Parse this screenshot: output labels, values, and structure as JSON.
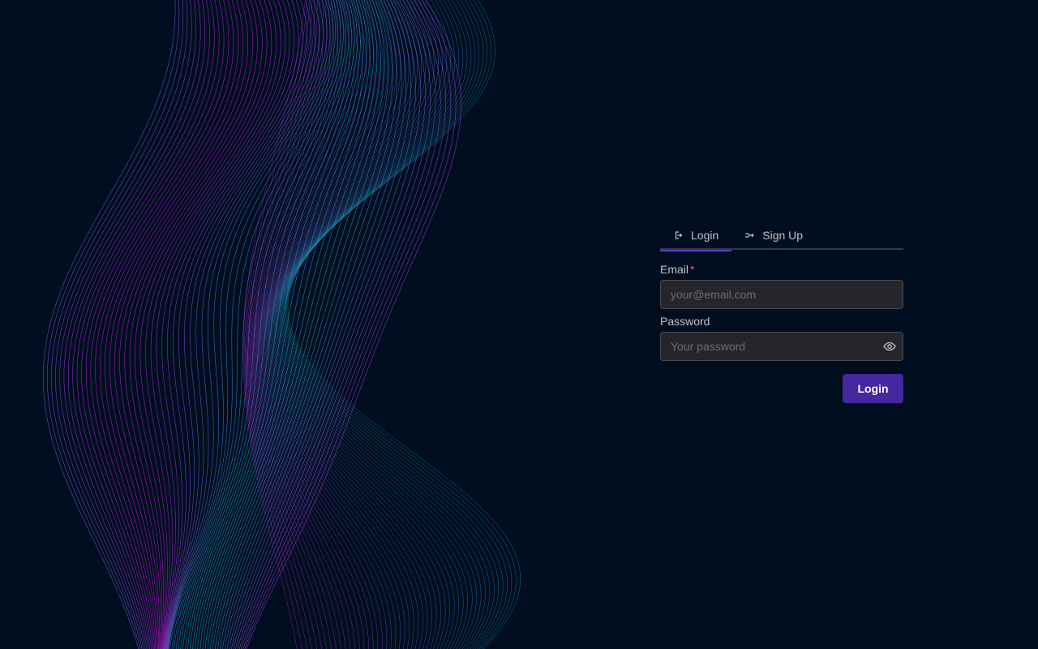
{
  "tabs": [
    {
      "label": "Login",
      "icon": "login-icon",
      "active": true
    },
    {
      "label": "Sign Up",
      "icon": "signup-icon",
      "active": false
    }
  ],
  "form": {
    "email": {
      "label": "Email",
      "required_mark": "*",
      "placeholder": "your@email.com",
      "value": ""
    },
    "password": {
      "label": "Password",
      "placeholder": "Your password",
      "value": "",
      "toggle_icon": "eye-icon"
    },
    "submit_label": "Login"
  },
  "colors": {
    "background": "#010e20",
    "accent": "#5f3dc4",
    "button": "#4527a0",
    "wave_cyan": "#12b6d6",
    "wave_magenta": "#d81bf0"
  }
}
